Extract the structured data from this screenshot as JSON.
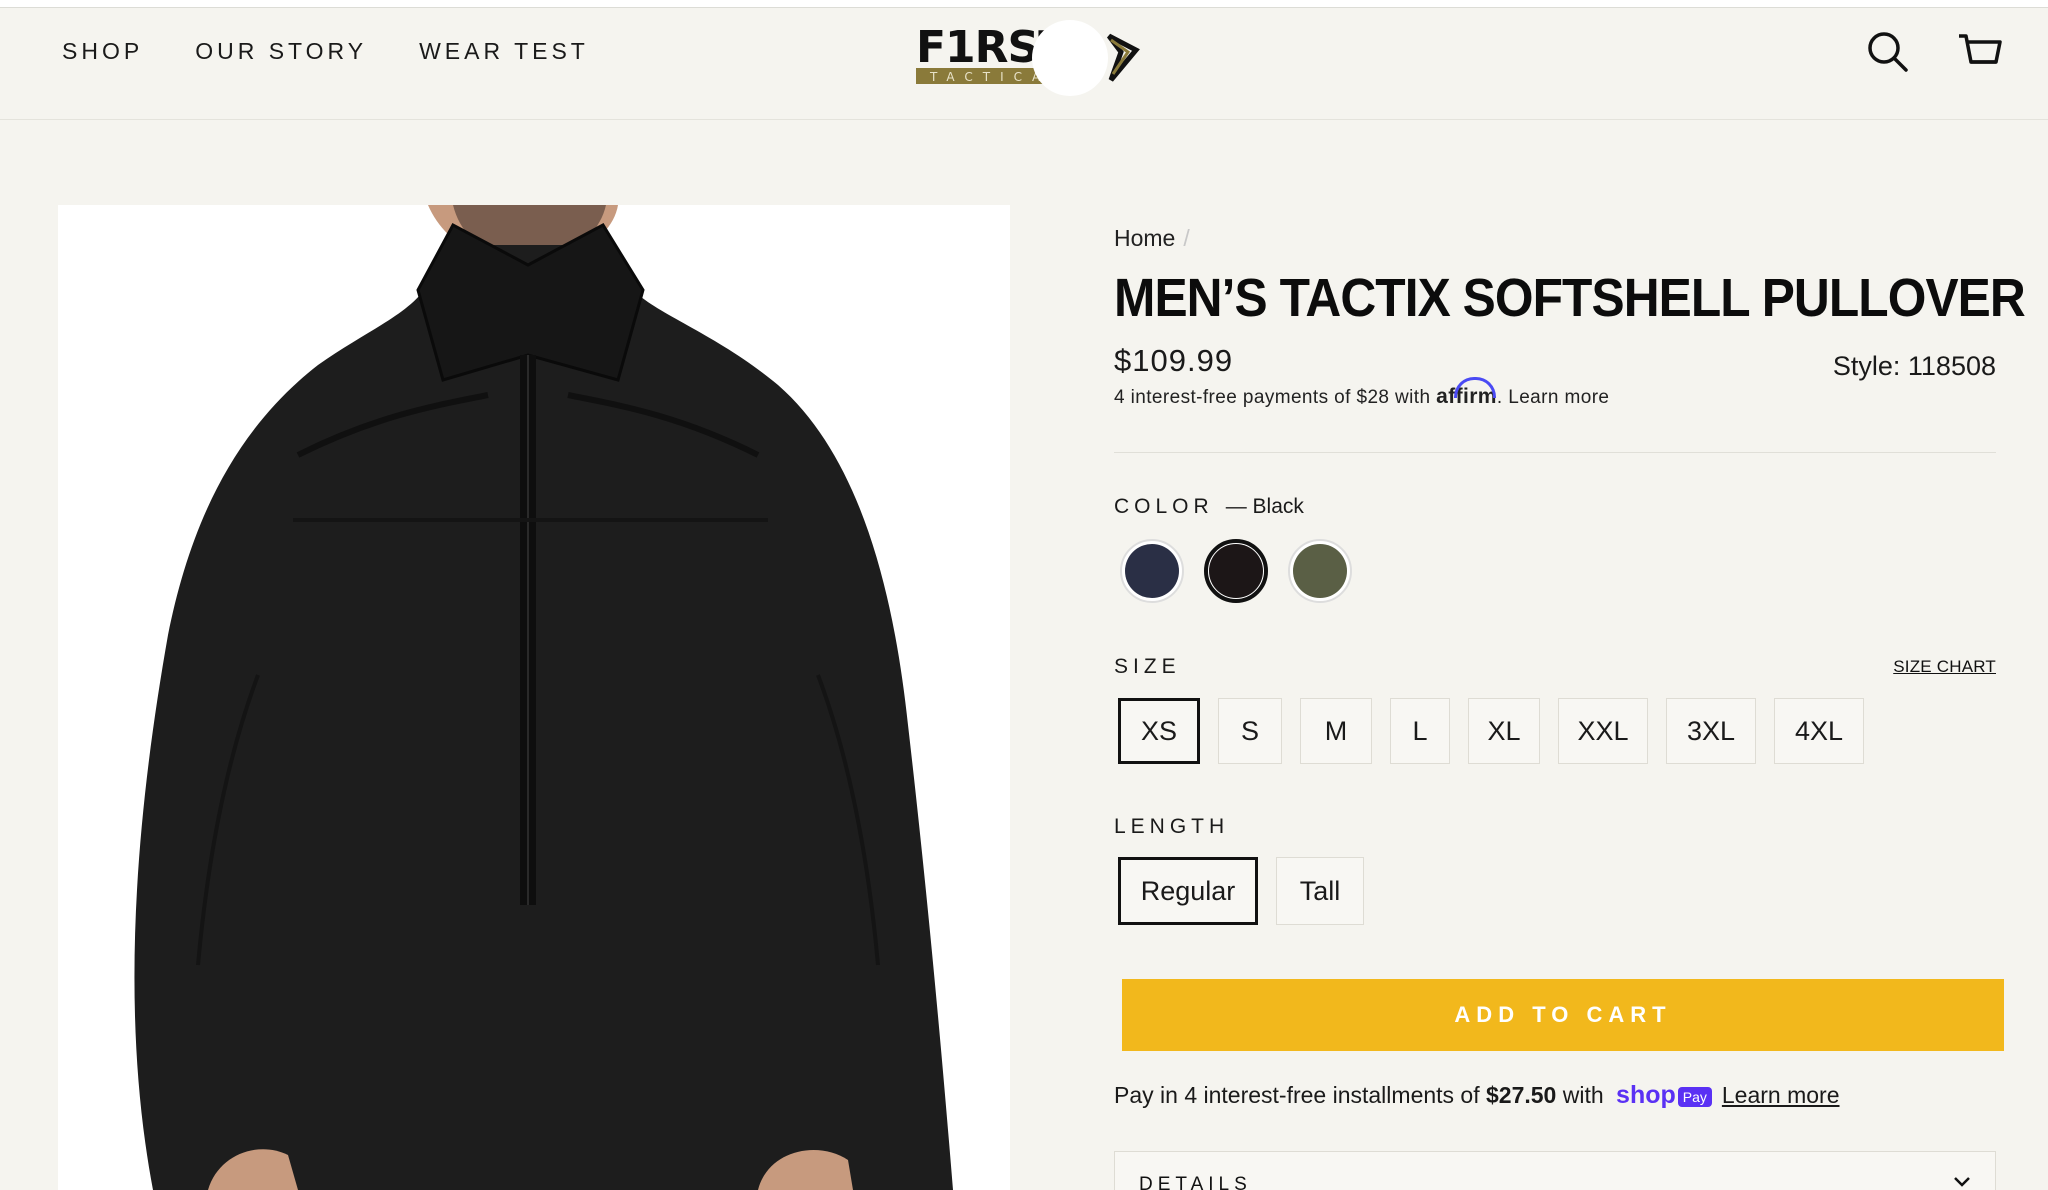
{
  "nav": {
    "items": [
      "SHOP",
      "OUR STORY",
      "WEAR TEST"
    ]
  },
  "logo": {
    "text": "F1RST",
    "subtext": "TACTICAL",
    "colors": {
      "main": "#111111",
      "band": "#8a7a3a"
    }
  },
  "header": {
    "search_icon": "search-icon",
    "cart_icon": "cart-icon"
  },
  "breadcrumb": {
    "home": "Home",
    "separator": "/"
  },
  "product": {
    "title": "MEN’S TACTIX SOFTSHELL PULLOVER",
    "price": "$109.99",
    "style": "Style: 118508",
    "affirm": {
      "prefix": "4 interest-free payments of $28 with ",
      "brand": "affirm",
      "suffix": ". Learn more"
    },
    "color": {
      "label": "COLOR",
      "current": "— Black",
      "swatches": [
        {
          "name": "Navy",
          "hex": "#2a2f45"
        },
        {
          "name": "Black",
          "hex": "#1c1617"
        },
        {
          "name": "OD Green",
          "hex": "#5a5f45"
        }
      ],
      "selected": 1
    },
    "size": {
      "label": "SIZE",
      "chart_link": "SIZE CHART",
      "options": [
        "XS",
        "S",
        "M",
        "L",
        "XL",
        "XXL",
        "3XL",
        "4XL"
      ],
      "selected": 0
    },
    "length": {
      "label": "LENGTH",
      "options": [
        "Regular",
        "Tall"
      ],
      "selected": 0
    },
    "add_to_cart": "ADD TO CART",
    "accent": "#f2b81c",
    "shoppay": {
      "prefix": "Pay in 4 interest-free installments of ",
      "amount": "$27.50",
      "mid": " with ",
      "shop": "shop",
      "pay": "Pay",
      "learn": "Learn more"
    },
    "details_label": "DETAILS"
  }
}
